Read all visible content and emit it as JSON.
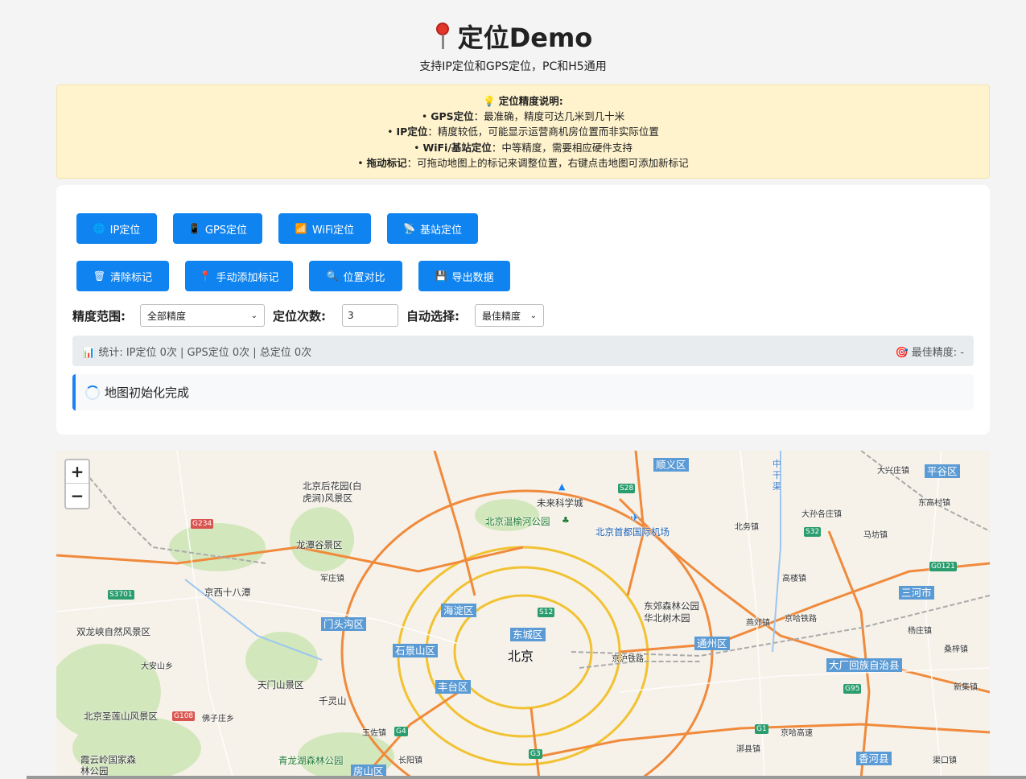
{
  "header": {
    "title": "定位Demo",
    "subtitle": "支持IP定位和GPS定位，PC和H5通用"
  },
  "note": {
    "heading": "定位精度说明:",
    "items": [
      {
        "label": "GPS定位",
        "text": "：最准确，精度可达几米到几十米"
      },
      {
        "label": "IP定位",
        "text": "：精度较低，可能显示运营商机房位置而非实际位置"
      },
      {
        "label": "WiFi/基站定位",
        "text": "：中等精度，需要相应硬件支持"
      },
      {
        "label": "拖动标记",
        "text": "：可拖动地图上的标记来调整位置，右键点击地图可添加新标记"
      }
    ]
  },
  "buttons": {
    "ip": "IP定位",
    "gps": "GPS定位",
    "wifi": "WiFi定位",
    "station": "基站定位",
    "clear": "清除标记",
    "manual": "手动添加标记",
    "compare": "位置对比",
    "export": "导出数据"
  },
  "controls": {
    "precision_label": "精度范围:",
    "precision_value": "全部精度",
    "count_label": "定位次数:",
    "count_value": "3",
    "auto_label": "自动选择:",
    "auto_value": "最佳精度"
  },
  "stats": {
    "text": "统计: IP定位 0次 | GPS定位 0次 | 总定位 0次",
    "best": "最佳精度: -"
  },
  "status": {
    "text": "地图初始化完成"
  },
  "map": {
    "zoom_in": "+",
    "zoom_out": "−",
    "city": "北京",
    "districts": [
      "顺义区",
      "平谷区",
      "海淀区",
      "东城区",
      "石景山区",
      "门头沟区",
      "丰台区",
      "通州区",
      "三河市",
      "大厂回族自治县",
      "香河县",
      "房山区"
    ],
    "places": [
      "北京后花园(白虎涧)风景区",
      "龙潭谷景区",
      "未来科学城",
      "北京温榆河公园",
      "北京首都国际机场",
      "京西十八潭",
      "双龙峡自然风景区",
      "大安山乡",
      "天门山景区",
      "千灵山",
      "北京圣莲山风景区",
      "佛子庄乡",
      "王佐镇",
      "青龙湖森林公园",
      "长阳镇",
      "东郊森林公园华北树木园",
      "高楼镇",
      "燕郊镇",
      "京哈铁路",
      "京沪铁路",
      "大孙各庄镇",
      "北务镇",
      "马坊镇",
      "东高村镇",
      "杨庄镇",
      "桑梓镇",
      "新集镇",
      "漷县镇",
      "京哈高速",
      "渠口镇",
      "大兴庄镇",
      "军庄镇",
      "霞云岭国家森林公园",
      "中干渠"
    ],
    "roads": [
      "G234",
      "S3701",
      "S28",
      "S32",
      "S12",
      "G108",
      "G4",
      "G3",
      "G1",
      "G95",
      "G0121"
    ]
  }
}
